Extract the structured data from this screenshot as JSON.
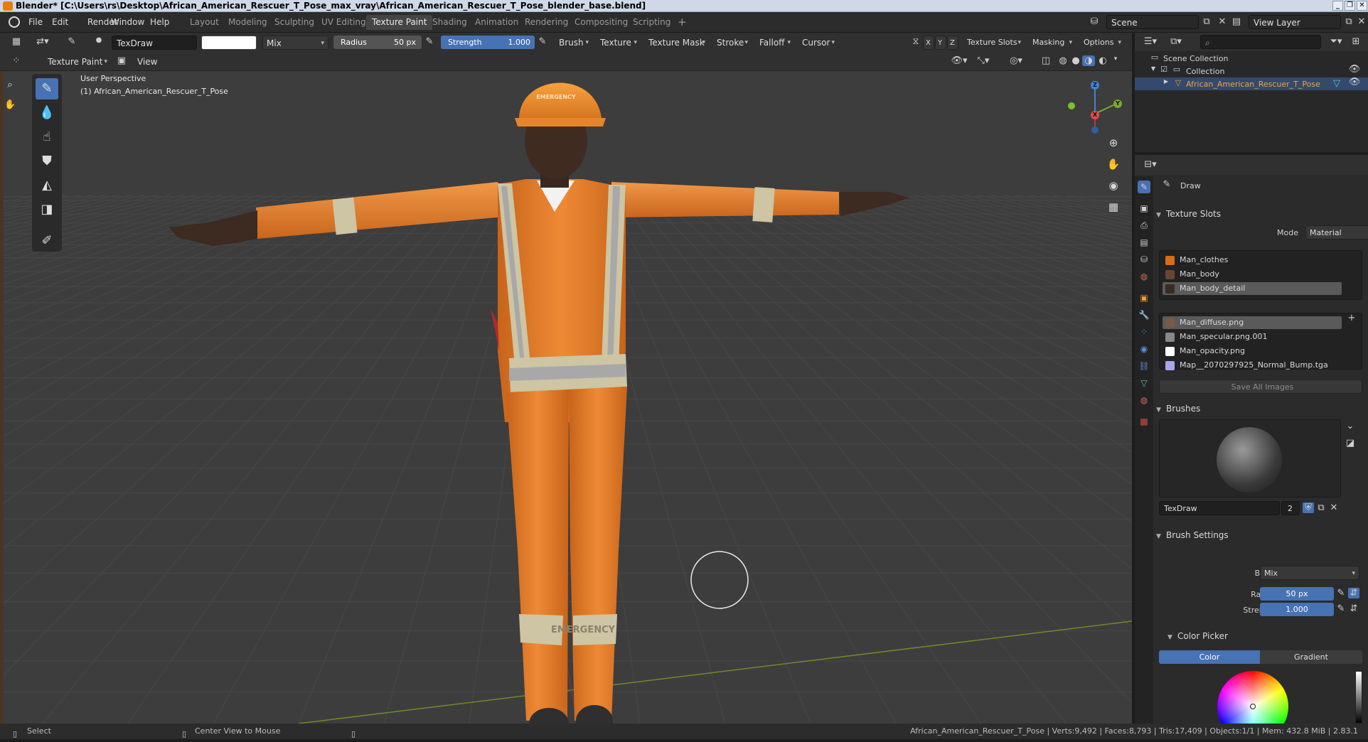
{
  "window": {
    "title": "Blender* [C:\\Users\\rs\\Desktop\\African_American_Rescuer_T_Pose_max_vray\\African_American_Rescuer_T_Pose_blender_base.blend]"
  },
  "menu": {
    "items": [
      "File",
      "Edit",
      "Render",
      "Window",
      "Help"
    ]
  },
  "workspaces": {
    "tabs": [
      "Layout",
      "Modeling",
      "Sculpting",
      "UV Editing",
      "Texture Paint",
      "Shading",
      "Animation",
      "Rendering",
      "Compositing",
      "Scripting"
    ],
    "active": "Texture Paint",
    "add": "+"
  },
  "scene": {
    "name": "Scene",
    "view_layer": "View Layer"
  },
  "toolheader": {
    "brush_name": "TexDraw",
    "blend": "Mix",
    "radius_label": "Radius",
    "radius_value": "50 px",
    "strength_label": "Strength",
    "strength_value": "1.000",
    "menus": [
      "Brush",
      "Texture",
      "Texture Mask",
      "Stroke",
      "Falloff",
      "Cursor"
    ],
    "axes": [
      "X",
      "Y",
      "Z"
    ],
    "right_menus": [
      "Texture Slots",
      "Masking",
      "Options"
    ],
    "color": "#ffffff"
  },
  "subheader": {
    "mode": "Texture Paint",
    "view": "View"
  },
  "viewport": {
    "perspective": "User Perspective",
    "object_info": "(1) African_American_Rescuer_T_Pose",
    "helmet_text": "EMERGENCY",
    "band_text": "EMERGENCY",
    "brush_cursor_visible": true
  },
  "tools": [
    {
      "name": "draw-tool",
      "glyph": "✎"
    },
    {
      "name": "soften-tool",
      "glyph": "💧"
    },
    {
      "name": "smear-tool",
      "glyph": "☝"
    },
    {
      "name": "clone-tool",
      "glyph": "⛊"
    },
    {
      "name": "fill-tool",
      "glyph": "◭"
    },
    {
      "name": "mask-tool",
      "glyph": "◨"
    },
    {
      "name": "annotate-tool",
      "glyph": "✐"
    }
  ],
  "outliner": {
    "scene_collection": "Scene Collection",
    "collection": "Collection",
    "object": "African_American_Rescuer_T_Pose"
  },
  "properties": {
    "tool_name": "Draw",
    "texture_slots": {
      "title": "Texture Slots",
      "mode_label": "Mode",
      "mode_value": "Material",
      "materials": [
        {
          "name": "Man_clothes",
          "color": "#d86e1a",
          "selected": false
        },
        {
          "name": "Man_body",
          "color": "#6a4432",
          "selected": false
        },
        {
          "name": "Man_body_detail",
          "color": "#3a2a22",
          "selected": true
        }
      ],
      "images": [
        {
          "name": "Man_diffuse.png",
          "color": "#7a5a45",
          "selected": true
        },
        {
          "name": "Man_specular.png.001",
          "color": "#888888",
          "selected": false
        },
        {
          "name": "Man_opacity.png",
          "color": "#ffffff",
          "selected": false
        },
        {
          "name": "Map__2070297925_Normal_Bump.tga",
          "color": "#a9a6f0",
          "selected": false
        }
      ],
      "save_all": "Save All Images"
    },
    "brushes": {
      "title": "Brushes",
      "brush_name": "TexDraw",
      "users": "2"
    },
    "brush_settings": {
      "title": "Brush Settings",
      "blend_label": "Blend",
      "blend_value": "Mix",
      "radius_label": "Radius",
      "radius_value": "50 px",
      "strength_label": "Strength",
      "strength_value": "1.000"
    },
    "color_picker": {
      "title": "Color Picker",
      "tab_color": "Color",
      "tab_gradient": "Gradient"
    }
  },
  "statusbar": {
    "select": "Select",
    "center": "Center View to Mouse",
    "stats": "African_American_Rescuer_T_Pose | Verts:9,492 | Faces:8,793 | Tris:17,409 | Objects:1/1 | Mem: 432.8 MiB | 2.83.1"
  }
}
